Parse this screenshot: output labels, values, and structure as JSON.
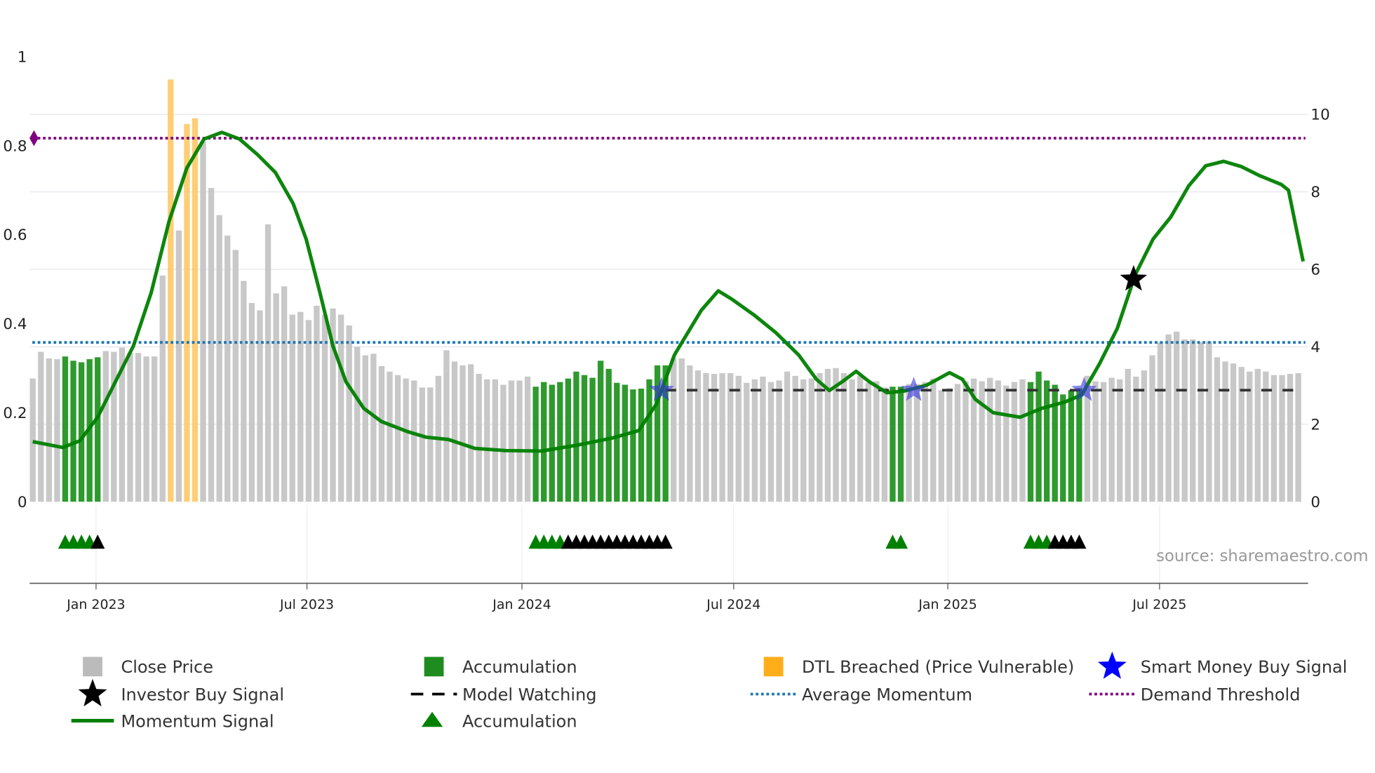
{
  "chart_data": {
    "type": "bar+line",
    "x_unit": "weeks since first bar",
    "start_week": "Nov 2022",
    "left_axis": {
      "range": [
        0,
        1
      ],
      "ticks": [
        0,
        0.2,
        0.4,
        0.6,
        0.8,
        1
      ],
      "labels": [
        "0",
        "0.2",
        "0.4",
        "0.6",
        "0.8",
        "1"
      ]
    },
    "right_axis": {
      "range": [
        0,
        11.5
      ],
      "ticks": [
        0,
        2,
        4,
        6,
        8,
        10
      ],
      "labels": [
        "0",
        "2",
        "4",
        "6",
        "8",
        "10"
      ]
    },
    "x_ticks": [
      {
        "label": "Jan 2023",
        "week": 7.8
      },
      {
        "label": "Jul 2023",
        "week": 33.8
      },
      {
        "label": "Jan 2024",
        "week": 60.3
      },
      {
        "label": "Jul 2024",
        "week": 86.4
      },
      {
        "label": "Jan 2025",
        "week": 112.8
      },
      {
        "label": "Jul 2025",
        "week": 138.9
      }
    ],
    "close_price": [
      3.18,
      3.87,
      3.7,
      3.68,
      3.75,
      3.64,
      3.6,
      3.68,
      3.73,
      3.89,
      3.87,
      3.98,
      3.84,
      3.84,
      3.75,
      3.75,
      5.84,
      10.9,
      7.0,
      9.75,
      9.9,
      9.3,
      8.1,
      7.4,
      6.87,
      6.5,
      5.7,
      5.13,
      4.94,
      7.16,
      5.38,
      5.56,
      4.83,
      4.9,
      4.69,
      5.06,
      4.83,
      4.99,
      4.83,
      4.55,
      4.0,
      3.78,
      3.82,
      3.5,
      3.36,
      3.27,
      3.18,
      3.13,
      2.95,
      2.95,
      3.25,
      3.91,
      3.62,
      3.52,
      3.55,
      3.3,
      3.16,
      3.16,
      3.02,
      3.13,
      3.13,
      3.23,
      2.97,
      3.09,
      3.02,
      3.09,
      3.18,
      3.36,
      3.27,
      3.2,
      3.64,
      3.43,
      3.07,
      3.02,
      2.9,
      2.92,
      3.16,
      3.52,
      3.52,
      3.7,
      3.7,
      3.52,
      3.39,
      3.32,
      3.3,
      3.32,
      3.32,
      3.25,
      3.07,
      3.16,
      3.23,
      3.09,
      3.13,
      3.36,
      3.25,
      3.16,
      3.18,
      3.32,
      3.43,
      3.45,
      3.32,
      3.16,
      3.25,
      3.07,
      3.11,
      2.95,
      2.97,
      2.97,
      3.04,
      3.04,
      3.09,
      3.18,
      2.88,
      2.93,
      3.04,
      3.11,
      3.18,
      3.11,
      3.2,
      3.13,
      3.0,
      3.09,
      3.16,
      3.09,
      3.36,
      3.13,
      3.02,
      2.77,
      2.88,
      2.93,
      3.25,
      3.11,
      3.09,
      3.2,
      3.16,
      3.43,
      3.23,
      3.39,
      3.78,
      4.12,
      4.32,
      4.39,
      4.19,
      4.19,
      4.12,
      4.14,
      3.73,
      3.62,
      3.57,
      3.48,
      3.36,
      3.43,
      3.36,
      3.27,
      3.27,
      3.3,
      3.32
    ],
    "accumulation_week_ranges": [
      [
        4,
        8
      ],
      [
        62,
        78
      ],
      [
        106,
        107
      ],
      [
        123,
        129
      ]
    ],
    "dtl_breached_weeks": [
      17,
      19,
      20
    ],
    "momentum_signal": [
      [
        0,
        0.135
      ],
      [
        3.7,
        0.122
      ],
      [
        5.8,
        0.137
      ],
      [
        8,
        0.19
      ],
      [
        10.2,
        0.27
      ],
      [
        12.4,
        0.35
      ],
      [
        14.6,
        0.47
      ],
      [
        16.8,
        0.63
      ],
      [
        19,
        0.75
      ],
      [
        21.1,
        0.815
      ],
      [
        23.3,
        0.83
      ],
      [
        25.5,
        0.815
      ],
      [
        27.7,
        0.78
      ],
      [
        29.9,
        0.74
      ],
      [
        32.1,
        0.67
      ],
      [
        33.7,
        0.59
      ],
      [
        35.4,
        0.47
      ],
      [
        37,
        0.35
      ],
      [
        38.6,
        0.27
      ],
      [
        40.8,
        0.21
      ],
      [
        43,
        0.18
      ],
      [
        46.3,
        0.157
      ],
      [
        48.5,
        0.145
      ],
      [
        51.2,
        0.14
      ],
      [
        54.5,
        0.12
      ],
      [
        58.3,
        0.115
      ],
      [
        62.7,
        0.114
      ],
      [
        67.1,
        0.127
      ],
      [
        71.4,
        0.143
      ],
      [
        74.7,
        0.16
      ],
      [
        76.9,
        0.22
      ],
      [
        79.1,
        0.33
      ],
      [
        82.4,
        0.43
      ],
      [
        84.5,
        0.474
      ],
      [
        86.2,
        0.455
      ],
      [
        88.9,
        0.42
      ],
      [
        91.6,
        0.38
      ],
      [
        94.4,
        0.33
      ],
      [
        96.6,
        0.275
      ],
      [
        98.2,
        0.25
      ],
      [
        99.8,
        0.27
      ],
      [
        101.5,
        0.293
      ],
      [
        103.1,
        0.27
      ],
      [
        105.3,
        0.245
      ],
      [
        107.5,
        0.249
      ],
      [
        110.2,
        0.262
      ],
      [
        113,
        0.29
      ],
      [
        114.6,
        0.275
      ],
      [
        116.2,
        0.23
      ],
      [
        118.4,
        0.2
      ],
      [
        121.7,
        0.19
      ],
      [
        124.4,
        0.21
      ],
      [
        127.2,
        0.224
      ],
      [
        129.3,
        0.24
      ],
      [
        131.5,
        0.31
      ],
      [
        133.7,
        0.39
      ],
      [
        135.9,
        0.51
      ],
      [
        138.1,
        0.59
      ],
      [
        140.3,
        0.64
      ],
      [
        142.5,
        0.71
      ],
      [
        144.6,
        0.755
      ],
      [
        146.8,
        0.765
      ],
      [
        149,
        0.753
      ],
      [
        151.2,
        0.733
      ],
      [
        153.9,
        0.713
      ],
      [
        154.8,
        0.7
      ],
      [
        155.8,
        0.61
      ],
      [
        156.6,
        0.54
      ]
    ],
    "average_momentum": 0.358,
    "demand_threshold": 0.817,
    "model_watching": {
      "level_right_axis": 2.88,
      "from_week": 78,
      "to_week": 156.6
    },
    "smart_money_buy_signals": [
      77.5,
      108.6,
      129.6
    ],
    "smart_money_level_right_axis": 2.88,
    "investor_buy_signals": [
      {
        "week": 135.7,
        "value": 0.5
      }
    ],
    "accumulation_triangles": [
      4,
      5,
      6,
      7,
      62,
      63,
      64,
      65,
      106,
      107,
      123,
      124,
      125
    ],
    "black_triangles": [
      8,
      66,
      67,
      68,
      69,
      70,
      71,
      72,
      73,
      74,
      75,
      76,
      77,
      78,
      126,
      127,
      128,
      129
    ],
    "source": "source: sharemaestro.com",
    "legend": [
      {
        "label": "Close Price",
        "color": "#bbbbbb",
        "symbol": "square"
      },
      {
        "label": "Accumulation",
        "color": "#1e8c1e",
        "symbol": "square"
      },
      {
        "label": "DTL Breached (Price Vulnerable)",
        "color": "#ffae1a",
        "symbol": "square"
      },
      {
        "label": "Smart Money Buy Signal",
        "color": "#0000ff",
        "symbol": "star"
      },
      {
        "label": "Investor Buy Signal",
        "color": "#000000",
        "symbol": "star"
      },
      {
        "label": "Model Watching",
        "color": "#000000",
        "symbol": "dash"
      },
      {
        "label": "Average Momentum",
        "color": "#1f77b4",
        "symbol": "dot"
      },
      {
        "label": "Demand Threshold",
        "color": "#800080",
        "symbol": "dot"
      },
      {
        "label": "Momentum Signal",
        "color": "#008000",
        "symbol": "line"
      },
      {
        "label": "Accumulation",
        "color": "#008000",
        "symbol": "triangle"
      }
    ]
  }
}
